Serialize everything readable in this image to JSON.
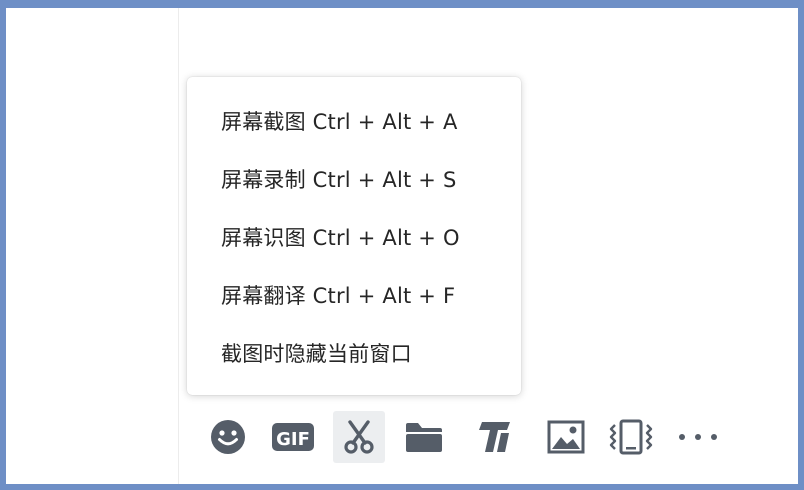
{
  "context_menu": {
    "items": [
      {
        "label": "屏幕截图 Ctrl + Alt + A"
      },
      {
        "label": "屏幕录制 Ctrl + Alt + S"
      },
      {
        "label": "屏幕识图 Ctrl + Alt + O"
      },
      {
        "label": "屏幕翻译 Ctrl + Alt + F"
      },
      {
        "label": "截图时隐藏当前窗口"
      }
    ]
  },
  "toolbar": {
    "icons": [
      "emoji-icon",
      "gif-icon",
      "scissors-icon",
      "folder-icon",
      "text-style-icon",
      "image-icon",
      "shake-icon",
      "more-icon"
    ],
    "gif_label": "GIF",
    "active": "scissors-icon"
  },
  "colors": {
    "frame": "#6e8fc6",
    "icon": "#555d68",
    "menu_text": "#262626",
    "active_bg": "#eceef0"
  }
}
